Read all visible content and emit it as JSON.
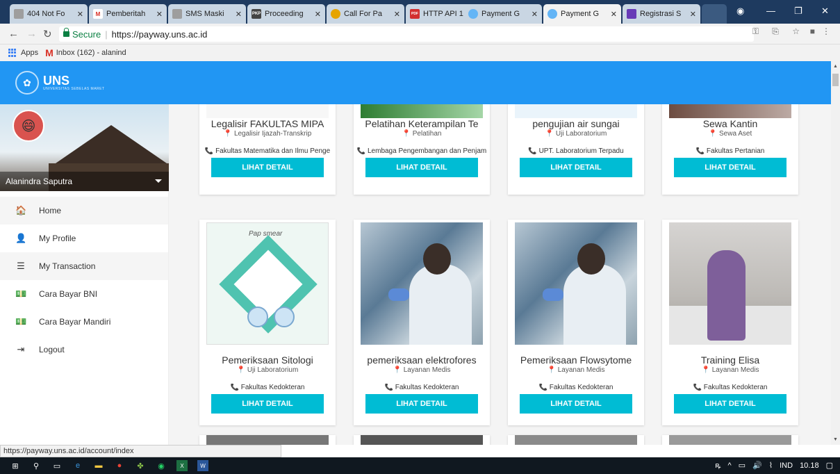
{
  "browser": {
    "tabs": [
      {
        "title": "404 Not Fo",
        "favicon_color": "#9e9e9e",
        "favicon": "globe-icon"
      },
      {
        "title": "Pemberitah",
        "favicon_color": "#d93025",
        "favicon": "gmail-icon",
        "favicon_text": "M"
      },
      {
        "title": "SMS Maski",
        "favicon_color": "#9e9e9e",
        "favicon": "document-icon"
      },
      {
        "title": "Proceeding",
        "favicon_color": "#444444",
        "favicon": "pkp-icon",
        "favicon_text": "PKP"
      },
      {
        "title": "Call For Pa",
        "favicon_color": "#e6a400",
        "favicon": "circle-icon"
      },
      {
        "title": "HTTP API 1",
        "favicon_color": "#d32f2f",
        "favicon": "pdf-icon",
        "favicon_text": "PDF"
      },
      {
        "title": "Payment G",
        "favicon_color": "#64b5f6",
        "favicon": "uns-icon"
      },
      {
        "title": "Payment G",
        "favicon_color": "#64b5f6",
        "favicon": "uns-icon",
        "active": true
      },
      {
        "title": "Registrasi S",
        "favicon_color": "#673ab7",
        "favicon": "form-icon"
      }
    ],
    "address": {
      "secure_label": "Secure",
      "url": "https://payway.uns.ac.id"
    },
    "bookmarks": [
      {
        "label": "Apps",
        "icon": "apps-grid-icon"
      },
      {
        "label": "Inbox (162) - alanind",
        "icon": "gmail-icon"
      }
    ],
    "status_url": "https://payway.uns.ac.id/account/index"
  },
  "header": {
    "logo_title": "UNS",
    "logo_subtitle": "UNIVERSITAS SEBELAS MARET"
  },
  "sidebar": {
    "user_name": "Alanindra Saputra",
    "items": [
      {
        "label": "Home",
        "icon": "home-icon",
        "glyph": "🏠"
      },
      {
        "label": "My Profile",
        "icon": "user-icon",
        "glyph": "👤"
      },
      {
        "label": "My Transaction",
        "icon": "list-icon",
        "glyph": "☰"
      },
      {
        "label": "Cara Bayar BNI",
        "icon": "money-icon",
        "glyph": "💵"
      },
      {
        "label": "Cara Bayar Mandiri",
        "icon": "money-icon",
        "glyph": "💵"
      },
      {
        "label": "Logout",
        "icon": "logout-icon",
        "glyph": "⇥"
      }
    ]
  },
  "cards_row1": [
    {
      "title": "Legalisir FAKULTAS MIPA",
      "category": "Legalisir Ijazah-Transkrip",
      "location": "Fakultas Matematika dan Ilmu Penge",
      "button": "LIHAT DETAIL"
    },
    {
      "title": "Pelatihan Keterampilan Te",
      "category": "Pelatihan",
      "location": "Lembaga Pengembangan dan Penjam",
      "button": "LIHAT DETAIL"
    },
    {
      "title": "pengujian air sungai",
      "category": "Uji Laboratorium",
      "location": "UPT. Laboratorium Terpadu",
      "button": "LIHAT DETAIL"
    },
    {
      "title": "Sewa Kantin",
      "category": "Sewa Aset",
      "location": "Fakultas Pertanian",
      "button": "LIHAT DETAIL"
    }
  ],
  "cards_row2": [
    {
      "title": "Pemeriksaan Sitologi",
      "category": "Uji Laboratorium",
      "location": "Fakultas Kedokteran",
      "button": "LIHAT DETAIL",
      "image_text": "Pap smear"
    },
    {
      "title": "pemeriksaan elektrofores",
      "category": "Layanan Medis",
      "location": "Fakultas Kedokteran",
      "button": "LIHAT DETAIL"
    },
    {
      "title": "Pemeriksaan Flowsytome",
      "category": "Layanan Medis",
      "location": "Fakultas Kedokteran",
      "button": "LIHAT DETAIL"
    },
    {
      "title": "Training Elisa",
      "category": "Layanan Medis",
      "location": "Fakultas Kedokteran",
      "button": "LIHAT DETAIL"
    }
  ],
  "taskbar": {
    "lang": "IND",
    "time": "10.18"
  },
  "colors": {
    "primary": "#2196f3",
    "button": "#00bcd4"
  }
}
